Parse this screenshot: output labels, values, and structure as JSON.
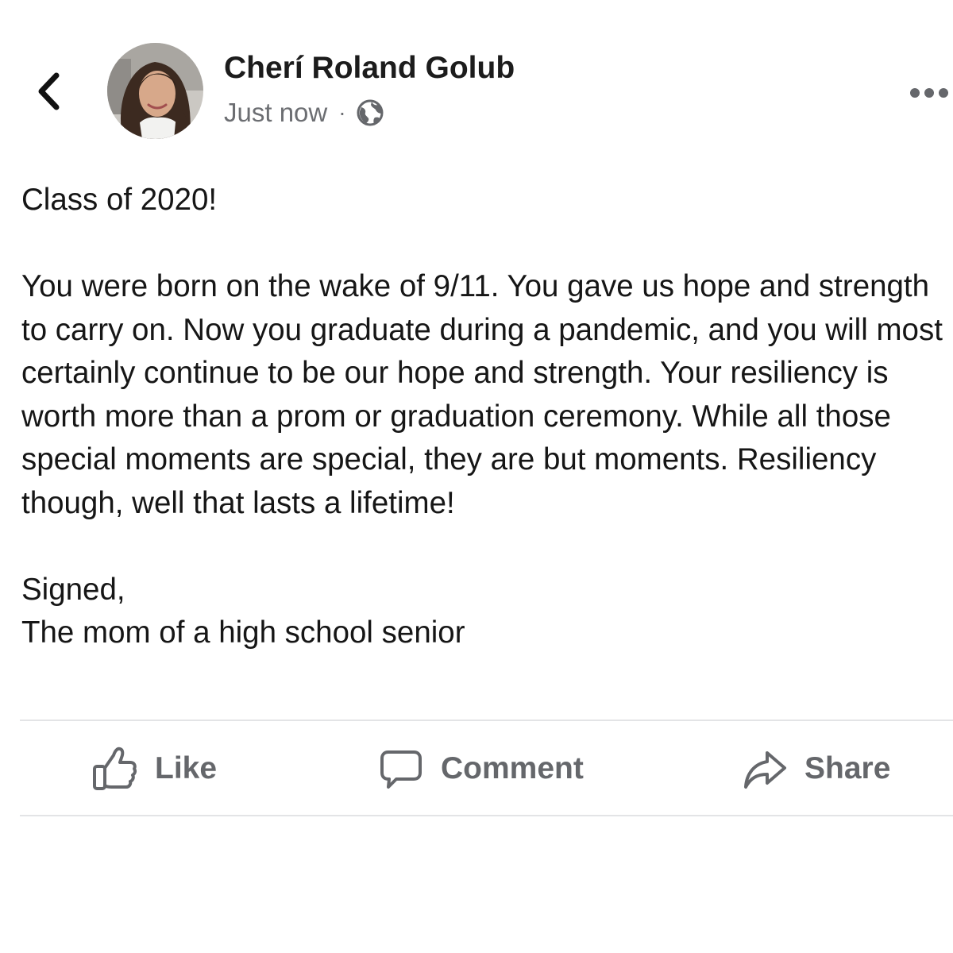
{
  "header": {
    "author_name": "Cherí Roland Golub",
    "timestamp": "Just now",
    "separator": "·",
    "audience_icon": "globe-icon",
    "back_icon": "chevron-left-icon",
    "more_icon": "more-horizontal-icon"
  },
  "post": {
    "paragraphs": [
      "Class of 2020!",
      "You were born on the wake of 9/11. You gave us hope and strength to carry on. Now you graduate during a pandemic, and you will most certainly continue to be our hope and strength. Your resiliency is worth more than a prom or graduation ceremony. While all those special moments are special, they are but moments. Resiliency though, well that lasts a lifetime!",
      "Signed,\nThe mom of a high school senior"
    ]
  },
  "actions": {
    "like": {
      "label": "Like",
      "icon": "thumbs-up-icon"
    },
    "comment": {
      "label": "Comment",
      "icon": "comment-bubble-icon"
    },
    "share": {
      "label": "Share",
      "icon": "share-arrow-icon"
    }
  },
  "colors": {
    "text": "#161616",
    "secondary_text": "#65676b",
    "divider": "#e3e4e6",
    "background": "#ffffff"
  }
}
